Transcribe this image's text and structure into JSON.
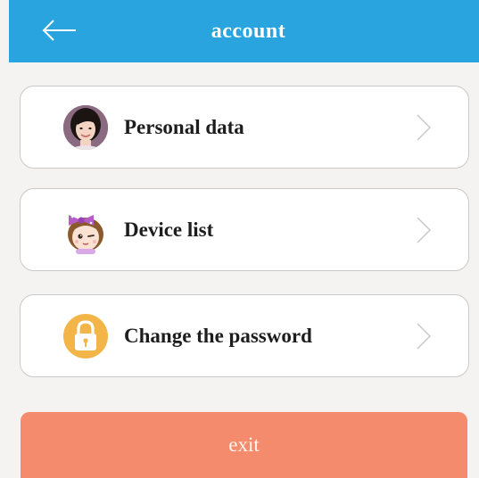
{
  "header": {
    "title": "account",
    "back_icon": "arrow-left-icon",
    "color": "#2aa4de"
  },
  "menu": {
    "items": [
      {
        "label": "Personal data",
        "icon": "woman-avatar-icon"
      },
      {
        "label": "Device list",
        "icon": "girl-bow-avatar-icon"
      },
      {
        "label": "Change the password",
        "icon": "lock-icon"
      }
    ]
  },
  "exit": {
    "label": "exit",
    "color": "#f48b6c"
  }
}
